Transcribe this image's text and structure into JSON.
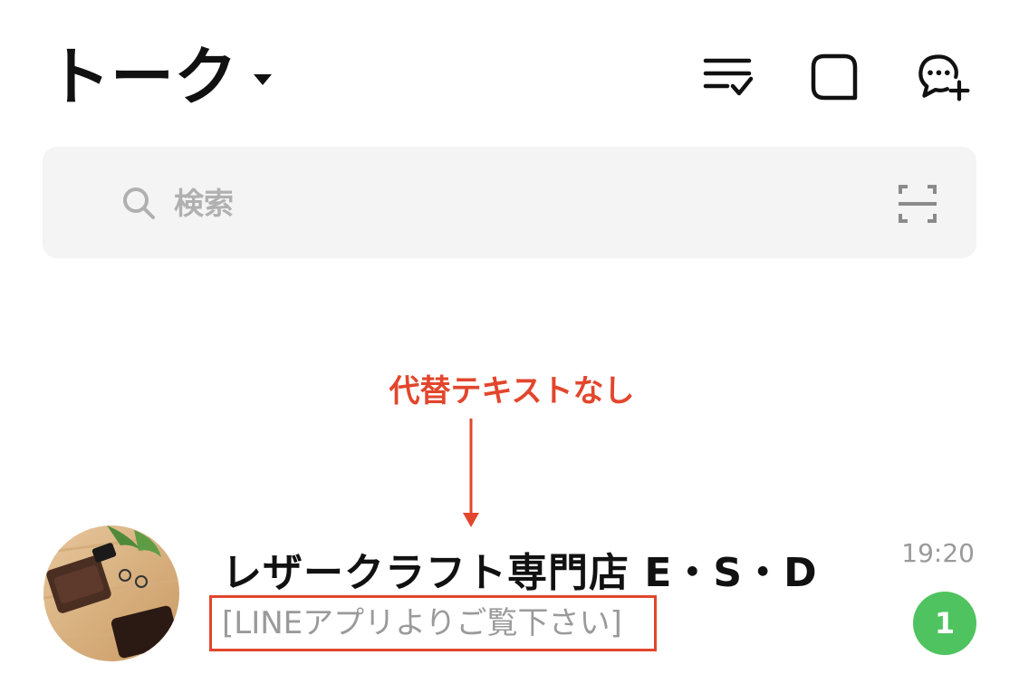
{
  "header": {
    "title": "トーク",
    "icons": {
      "edit_list": "list-check-icon",
      "open_chat": "rounded-square-icon",
      "new_chat": "chat-plus-icon"
    }
  },
  "search": {
    "placeholder": "検索",
    "value": "",
    "scan_icon": "scan-icon"
  },
  "annotation": {
    "label": "代替テキストなし",
    "color": "#e2462c"
  },
  "chats": [
    {
      "name": "レザークラフト専門店 E・S・D",
      "preview": "[LINEアプリよりご覧下さい]",
      "time": "19:20",
      "unread": "1"
    }
  ],
  "colors": {
    "accent_green": "#4fc35f",
    "annotation_red": "#e2462c",
    "search_bg": "#f4f4f4",
    "muted_text": "#9a9a9a"
  }
}
